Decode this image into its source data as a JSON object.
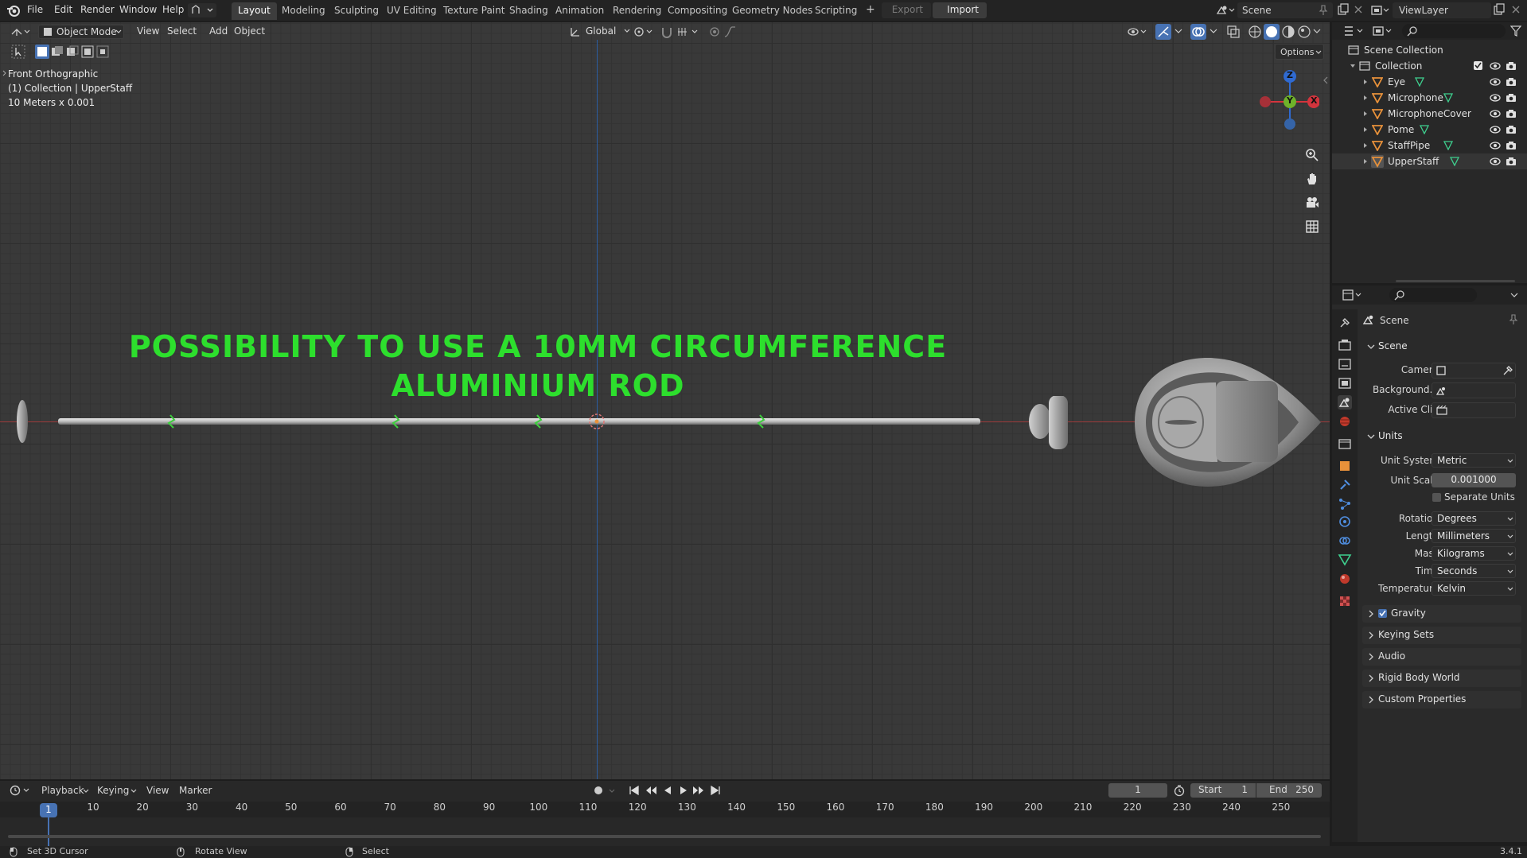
{
  "topbar": {
    "menus": [
      "File",
      "Edit",
      "Render",
      "Window",
      "Help"
    ],
    "workspaces": [
      "Layout",
      "Modeling",
      "Sculpting",
      "UV Editing",
      "Texture Paint",
      "Shading",
      "Animation",
      "Rendering",
      "Compositing",
      "Geometry Nodes",
      "Scripting"
    ],
    "add_workspace": "+",
    "export_label": "Export",
    "import_label": "Import",
    "scene_name": "Scene",
    "view_layer": "ViewLayer"
  },
  "viewport_header": {
    "mode": "Object Mode",
    "menus": [
      "View",
      "Select",
      "Add",
      "Object"
    ],
    "transform_orientation": "Global",
    "options_label": "Options"
  },
  "viewport": {
    "view_name": "Front Orthographic",
    "collection_info": "(1) Collection | UpperStaff",
    "scale_info": "10 Meters x 0.001",
    "banner_line1": "POSSIBILITY TO USE A 10MM CIRCUMFERENCE",
    "banner_line2": "ALUMINIUM ROD",
    "gizmo": {
      "z": "Z",
      "y": "Y",
      "x": "X"
    }
  },
  "outliner": {
    "root": "Scene Collection",
    "collection": "Collection",
    "objects": [
      "Eye",
      "Microphone",
      "MicrophoneCover",
      "Pome",
      "StaffPipe",
      "UpperStaff"
    ]
  },
  "properties": {
    "context": "Scene",
    "scene_section": "Scene",
    "camera_label": "Camera",
    "background_label": "Background...",
    "active_clip_label": "Active Clip",
    "units_section": "Units",
    "unit_system_label": "Unit System",
    "unit_system": "Metric",
    "unit_scale_label": "Unit Scale",
    "unit_scale": "0.001000",
    "separate_units": "Separate Units",
    "rotation_label": "Rotation",
    "rotation": "Degrees",
    "length_label": "Length",
    "length": "Millimeters",
    "mass_label": "Mass",
    "mass": "Kilograms",
    "time_label": "Time",
    "time": "Seconds",
    "temperature_label": "Temperature",
    "temperature": "Kelvin",
    "gravity": "Gravity",
    "collapsed_sections": [
      "Keying Sets",
      "Audio",
      "Rigid Body World",
      "Custom Properties"
    ]
  },
  "timeline": {
    "menus": [
      "Playback",
      "Keying",
      "View",
      "Marker"
    ],
    "current_frame": "1",
    "start_label": "Start",
    "start": "1",
    "end_label": "End",
    "end": "250",
    "ruler": [
      "10",
      "20",
      "30",
      "40",
      "50",
      "60",
      "70",
      "80",
      "90",
      "100",
      "110",
      "120",
      "130",
      "140",
      "150",
      "160",
      "170",
      "180",
      "190",
      "200",
      "210",
      "220",
      "230",
      "240",
      "250"
    ],
    "playhead": "1"
  },
  "statusbar": {
    "hint1": "Set 3D Cursor",
    "hint2": "Rotate View",
    "hint3": "Select",
    "version": "3.4.1"
  },
  "colors": {
    "banner": "#2ddf2d",
    "accent_blue": "#4772b3",
    "object_orange": "#e8913a",
    "mesh_green": "#3ecf8e"
  }
}
